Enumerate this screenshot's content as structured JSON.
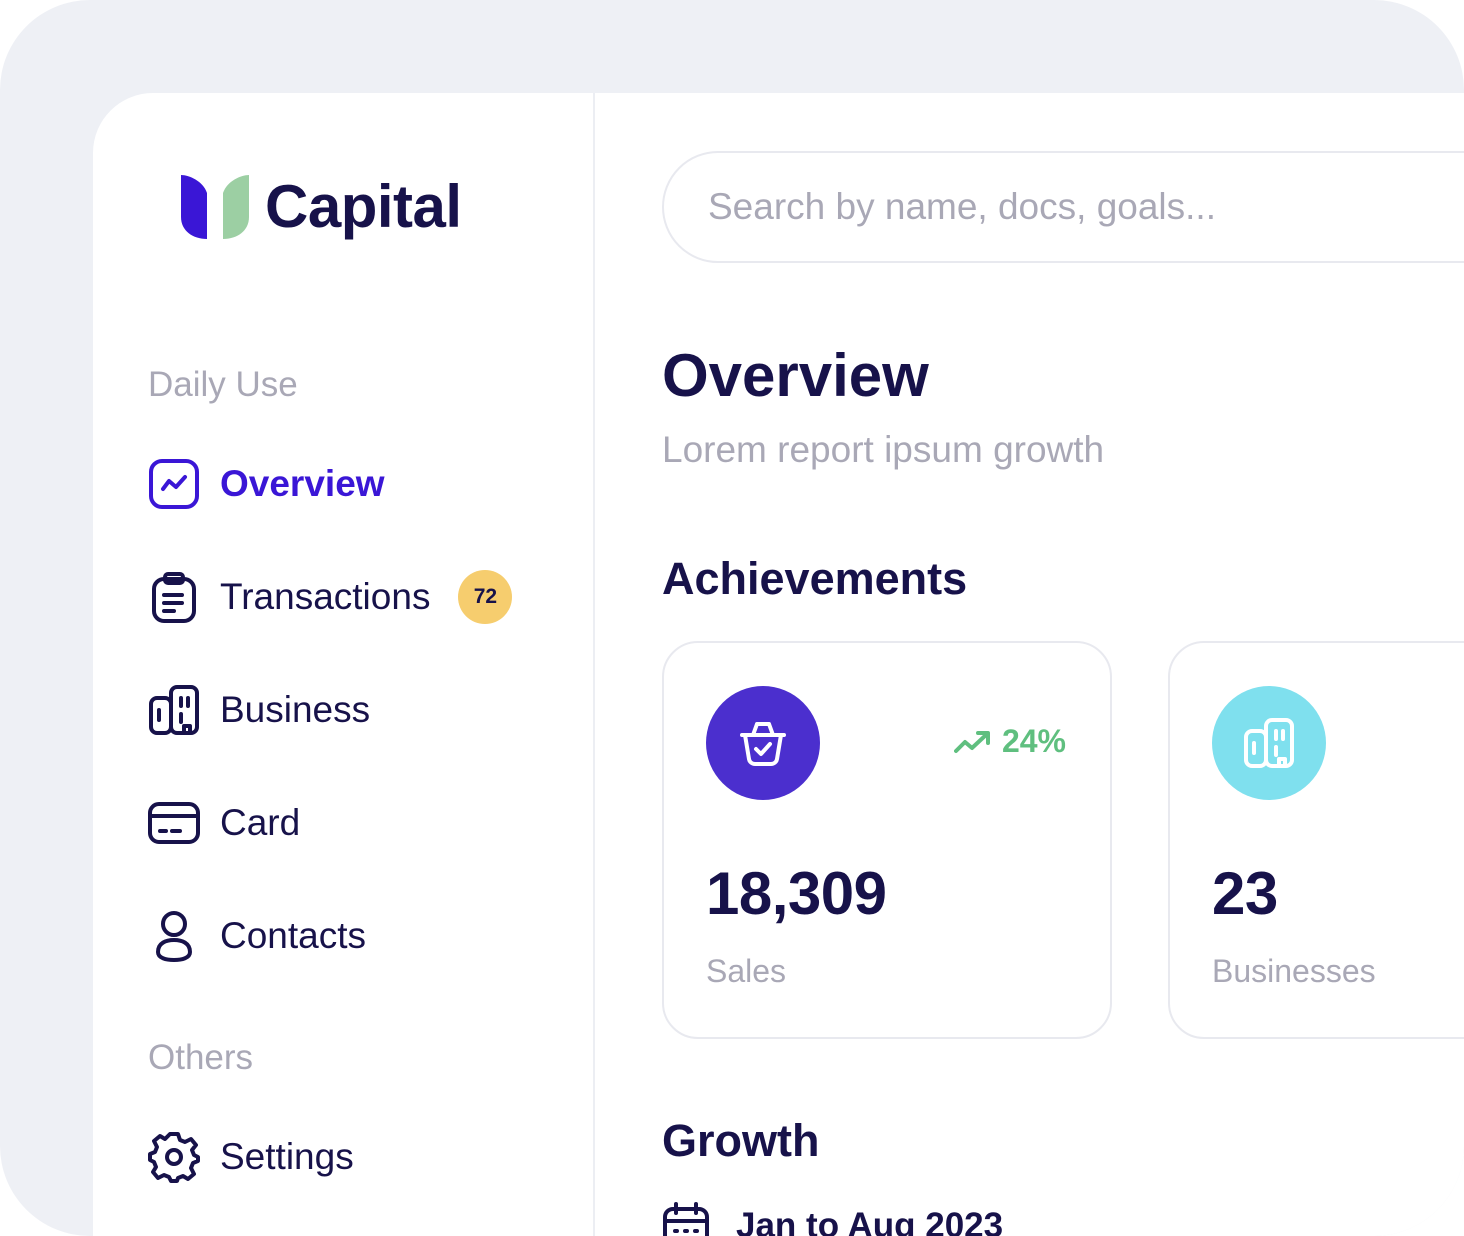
{
  "brand": {
    "name": "Capital"
  },
  "sidebar": {
    "sections": [
      {
        "label": "Daily Use"
      },
      {
        "label": "Others"
      }
    ],
    "items": [
      {
        "label": "Overview",
        "icon": "chart-square-icon",
        "active": true
      },
      {
        "label": "Transactions",
        "icon": "clipboard-icon",
        "badge": "72"
      },
      {
        "label": "Business",
        "icon": "building-icon"
      },
      {
        "label": "Card",
        "icon": "credit-card-icon"
      },
      {
        "label": "Contacts",
        "icon": "user-icon"
      },
      {
        "label": "Settings",
        "icon": "gear-icon"
      }
    ]
  },
  "search": {
    "placeholder": "Search by name, docs, goals..."
  },
  "main": {
    "title": "Overview",
    "subtitle": "Lorem report ipsum growth",
    "achievements_title": "Achievements",
    "cards": [
      {
        "value": "18,309",
        "label": "Sales",
        "trend": "24%",
        "icon": "basket-icon",
        "icon_bg": "#4b2fce"
      },
      {
        "value": "23",
        "label": "Businesses",
        "icon": "building-icon",
        "icon_bg": "#7fe0ee"
      }
    ],
    "growth_title": "Growth",
    "growth_period": "Jan to Aug 2023"
  },
  "colors": {
    "accent": "#3a16d6",
    "text": "#17124a",
    "muted": "#a9a8b6",
    "badge": "#f6cd6e",
    "positive": "#5fbf7f"
  }
}
